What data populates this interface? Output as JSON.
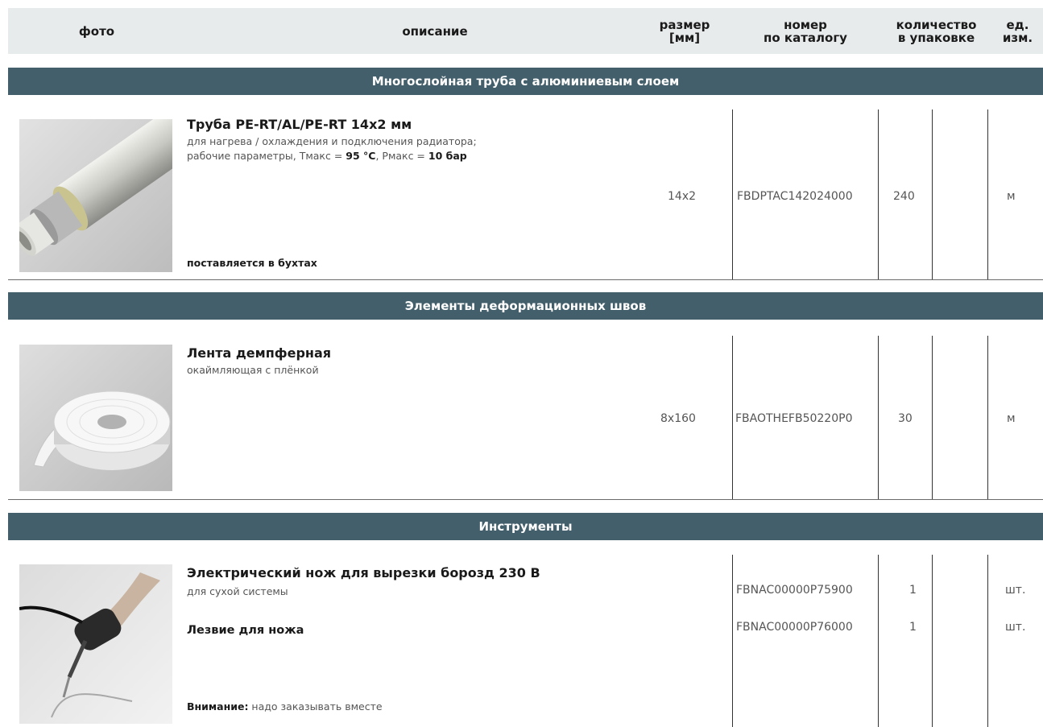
{
  "header": {
    "photo": "фото",
    "description": "описание",
    "size_l1": "размер",
    "size_l2": "[мм]",
    "catalog_l1": "номер",
    "catalog_l2": "по каталогу",
    "qty_l1": "количество",
    "qty_l2": "в упаковке",
    "unit": "ед. изм."
  },
  "sections": [
    {
      "title": "Многослойная труба с алюминиевым слоем",
      "product": {
        "photo_icon": "multilayer-pipe-photo",
        "title": "Труба PE-RT/AL/PE-RT 14x2 мм",
        "desc1": "для нагрева / охлаждения и подключения радиатора;",
        "desc2_prefix": "рабочие параметры, Tмакс = ",
        "desc2_t": "95 °C",
        "desc2_mid": ", Pмакс = ",
        "desc2_p": "10 бар",
        "note": "поставляется в бухтах",
        "size": "14x2",
        "catalog": "FBDPTAC142024000",
        "qty": "240",
        "unit": "м"
      }
    },
    {
      "title": "Элементы деформационных швов",
      "product": {
        "photo_icon": "damper-tape-roll-photo",
        "title": "Лента демпферная",
        "desc1": "окаймляющая с плёнкой",
        "size": "8x160",
        "catalog": "FBAOTHEFB50220P0",
        "qty": "30",
        "unit": "м"
      }
    },
    {
      "title": "Инструменты",
      "product": {
        "photo_icon": "electric-knife-photo",
        "title": "Электрический нож для вырезки борозд 230 В",
        "desc1": "для сухой системы",
        "title2": "Лезвие для ножа",
        "note_bold": "Внимание:",
        "note_plain": " надо заказывать вместе",
        "catalog1": "FBNAC00000P75900",
        "qty1": "1",
        "unit1": "шт.",
        "catalog2": "FBNAC00000P76000",
        "qty2": "1",
        "unit2": "шт."
      }
    }
  ]
}
